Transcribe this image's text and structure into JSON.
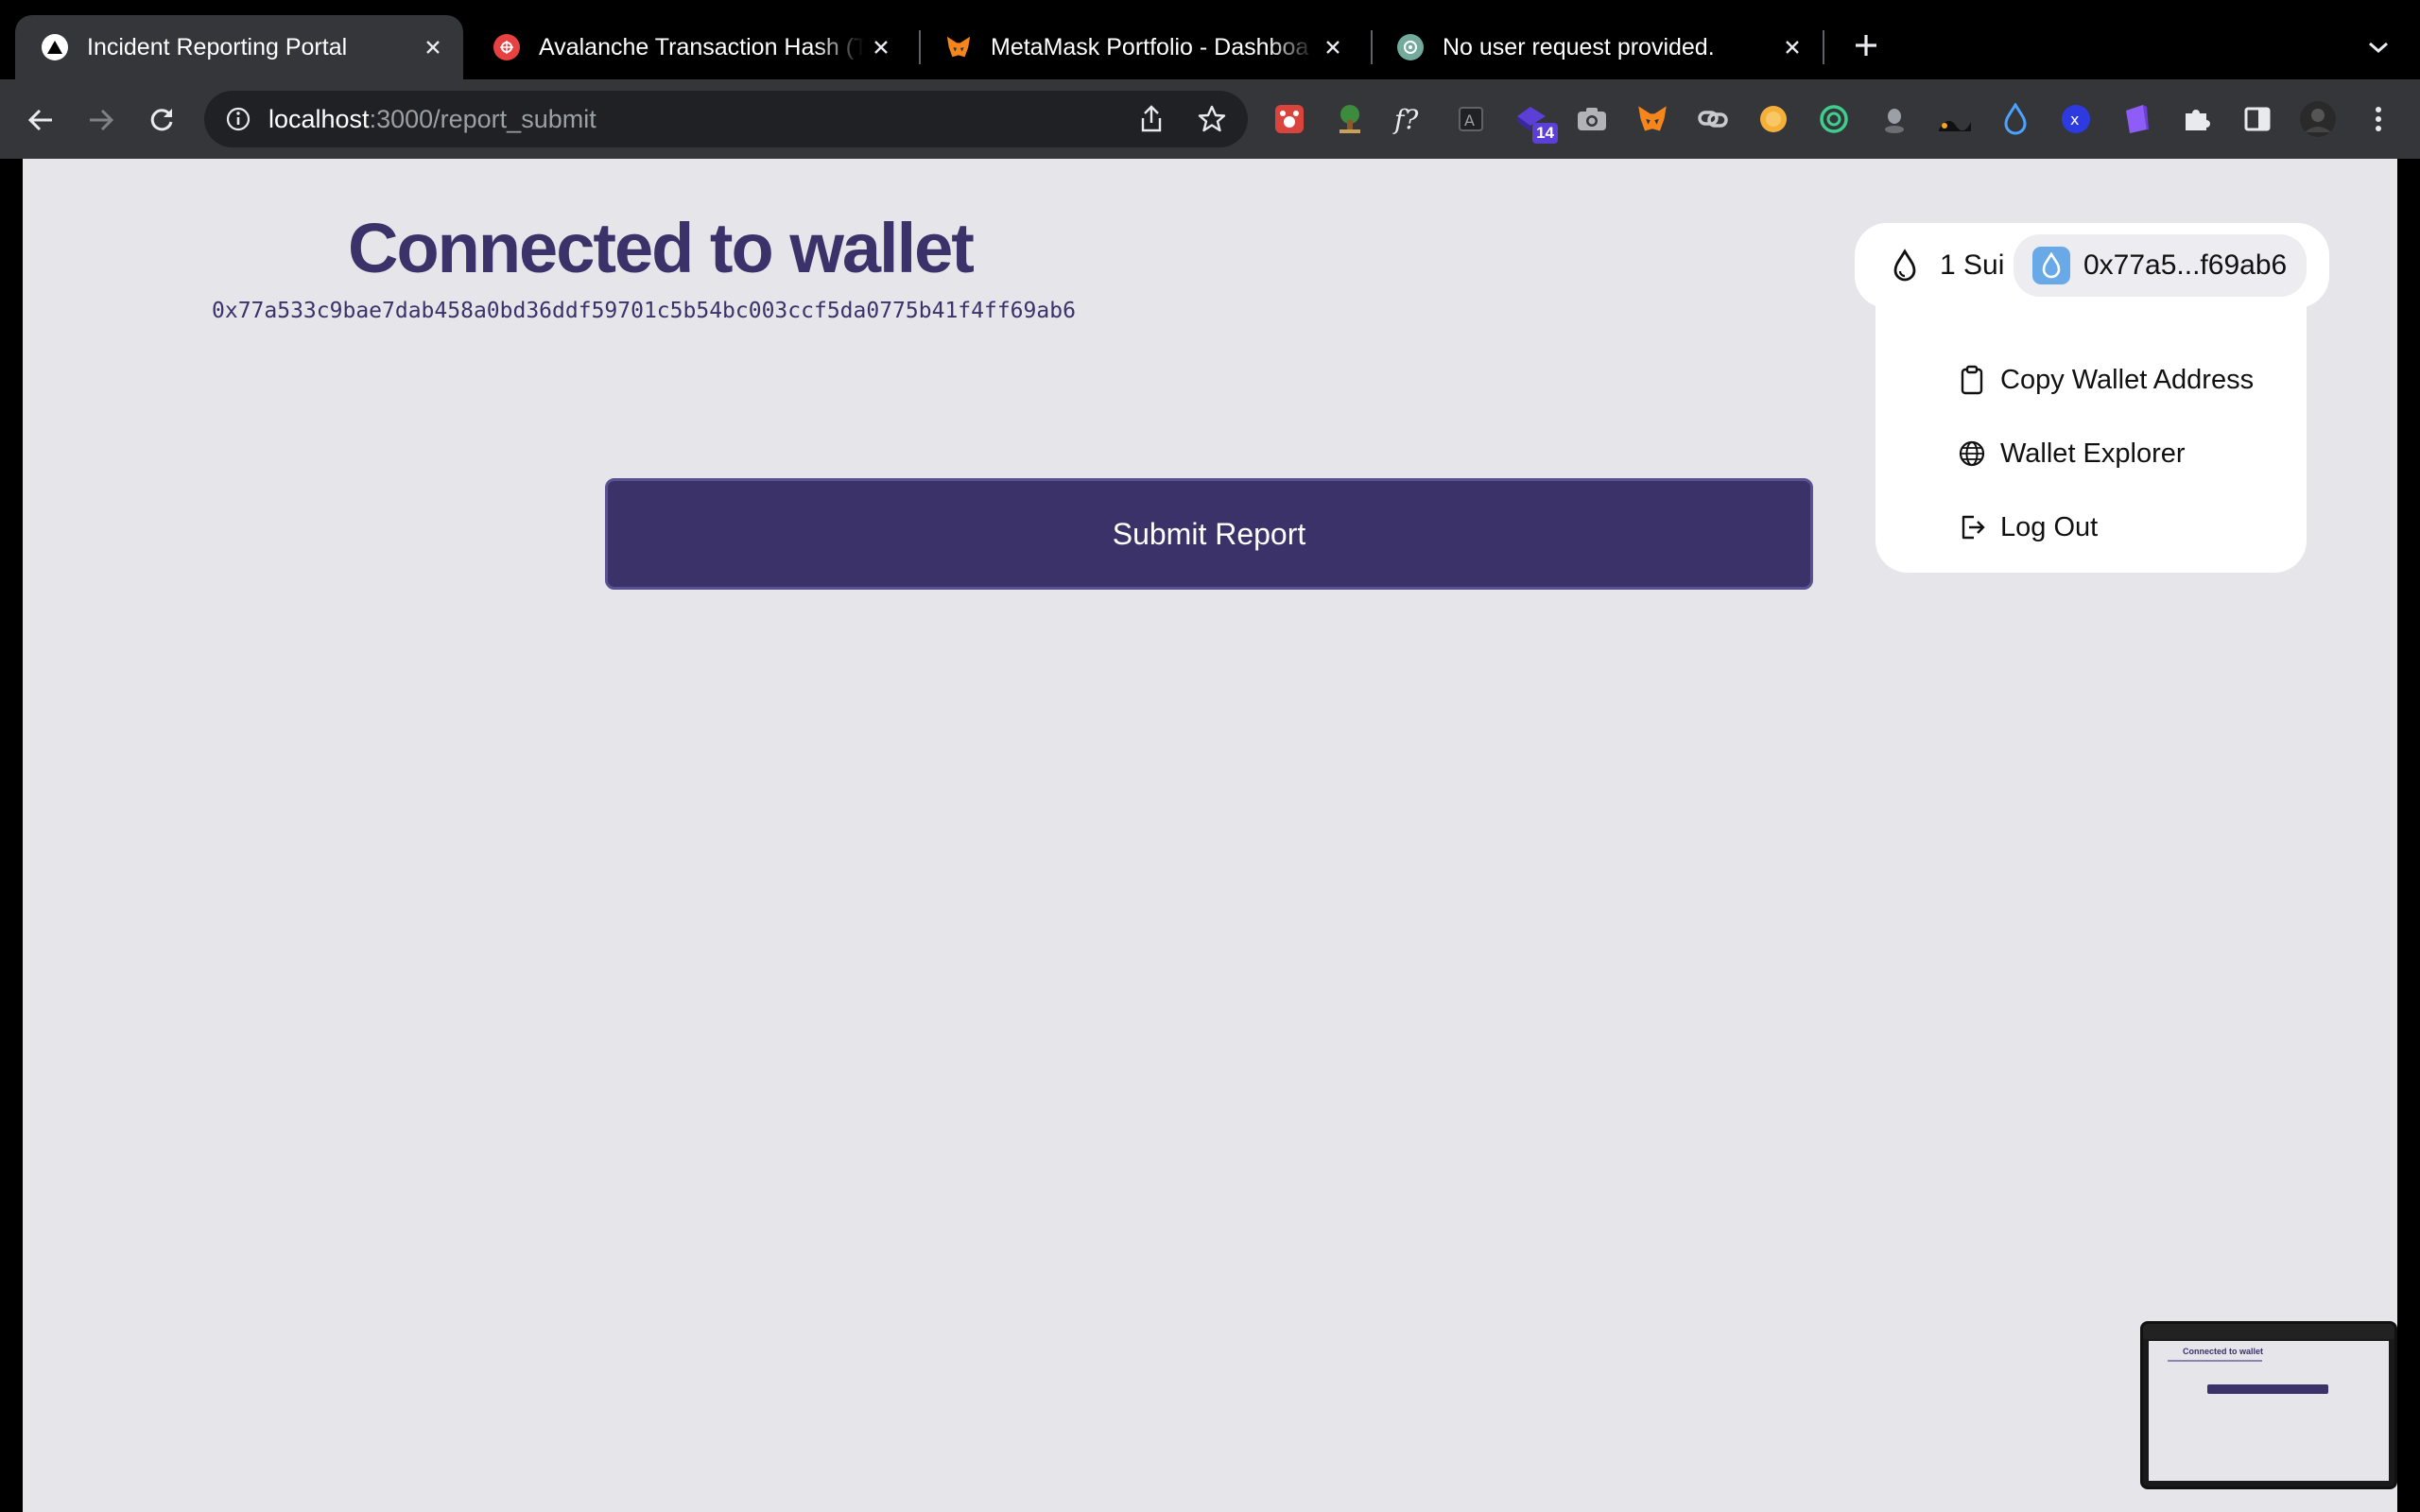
{
  "browser": {
    "tabs": [
      {
        "title": "Incident Reporting Portal",
        "active": true,
        "favicon": "triangle-icon"
      },
      {
        "title": "Avalanche Transaction Hash (T",
        "active": false,
        "favicon": "avalanche-icon"
      },
      {
        "title": "MetaMask Portfolio - Dashboa",
        "active": false,
        "favicon": "metamask-fox-icon"
      },
      {
        "title": "No user request provided.",
        "active": false,
        "favicon": "chatgpt-icon"
      }
    ],
    "url_host": "localhost",
    "url_path": ":3000/report_submit",
    "extensions": [
      {
        "name": "red-paw-extension-icon"
      },
      {
        "name": "tree-extension-icon"
      },
      {
        "name": "function-f-extension-icon"
      },
      {
        "name": "box-a-extension-icon"
      },
      {
        "name": "purple-wallet-extension-icon",
        "badge": "14"
      },
      {
        "name": "camera-extension-icon"
      },
      {
        "name": "metamask-extension-icon"
      },
      {
        "name": "link-extension-icon"
      },
      {
        "name": "orange-coin-extension-icon"
      },
      {
        "name": "green-ring-extension-icon"
      },
      {
        "name": "robot-extension-icon"
      },
      {
        "name": "ink-extension-icon"
      },
      {
        "name": "sui-drop-extension-icon"
      },
      {
        "name": "x-circle-extension-icon"
      },
      {
        "name": "purple-cube-extension-icon"
      },
      {
        "name": "puzzle-extensions-icon"
      },
      {
        "name": "side-panel-icon"
      },
      {
        "name": "profile-avatar-icon"
      },
      {
        "name": "kebab-menu-icon"
      }
    ]
  },
  "page": {
    "heading": "Connected to wallet",
    "address": "0x77a533c9bae7dab458a0bd36ddf59701c5b54bc003ccf5da0775b41f4ff69ab6",
    "submit_label": "Submit Report"
  },
  "wallet": {
    "balance": "1 Sui",
    "short_address": "0x77a5...f69ab6",
    "menu": [
      {
        "label": "Copy Wallet Address",
        "icon": "clipboard-icon"
      },
      {
        "label": "Wallet Explorer",
        "icon": "globe-icon"
      },
      {
        "label": "Log Out",
        "icon": "logout-icon"
      }
    ]
  },
  "preview_thumbnail": {
    "title": "Connected to wallet"
  },
  "colors": {
    "brand": "#3b3269",
    "page_bg": "#e5e5ea",
    "sui_blue": "#6aa9e8"
  }
}
